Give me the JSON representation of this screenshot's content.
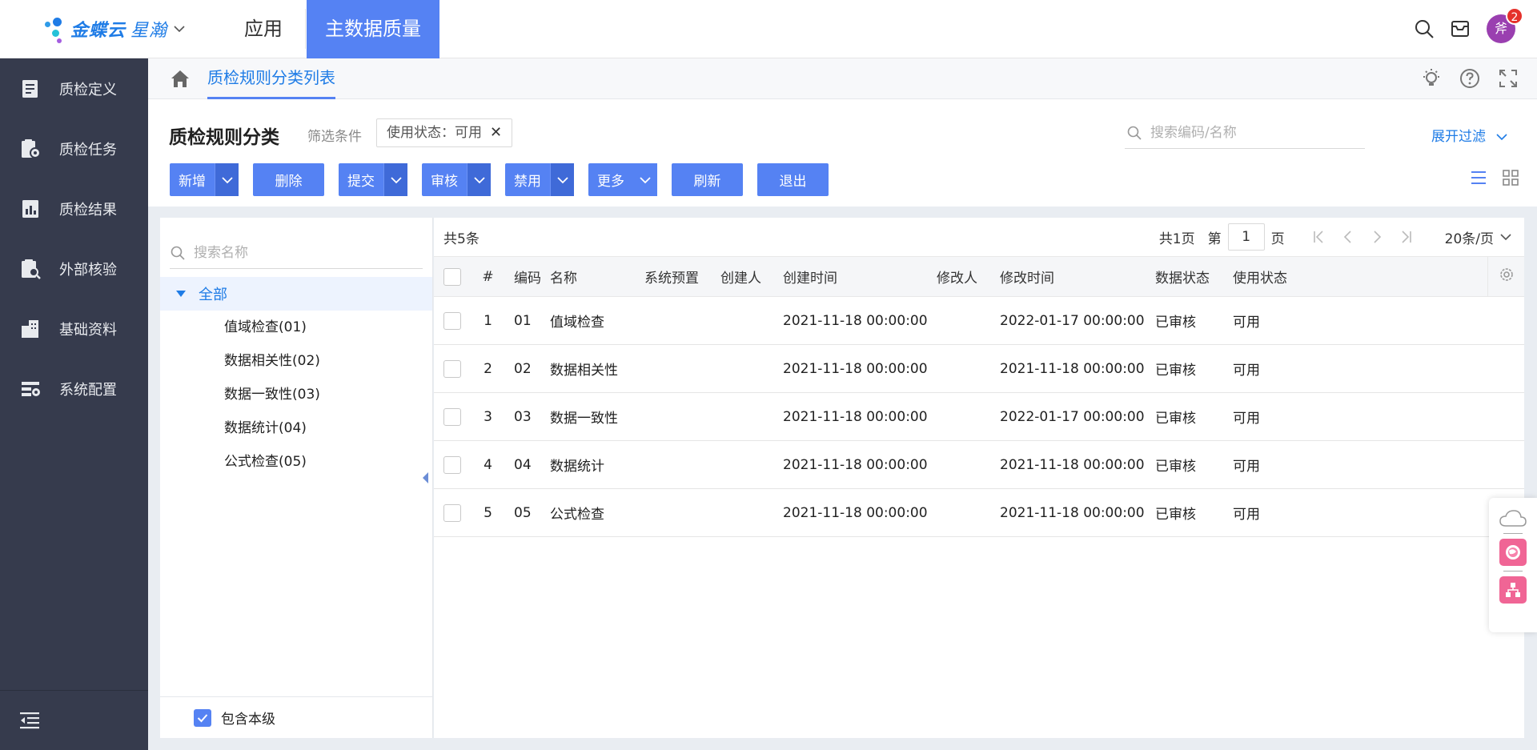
{
  "app": {
    "brand_main": "金蝶云",
    "brand_sub": "星瀚",
    "nav_apps": "应用",
    "nav_active": "主数据质量",
    "avatar_text": "斧",
    "notif_count": "2"
  },
  "sidebar": {
    "items": [
      {
        "label": "质检定义",
        "icon": "book-icon"
      },
      {
        "label": "质检任务",
        "icon": "task-gear-icon"
      },
      {
        "label": "质检结果",
        "icon": "report-icon"
      },
      {
        "label": "外部核验",
        "icon": "clipboard-search-icon"
      },
      {
        "label": "基础资料",
        "icon": "building-icon"
      },
      {
        "label": "系统配置",
        "icon": "config-icon"
      }
    ]
  },
  "breadcrumb": {
    "tab": "质检规则分类列表"
  },
  "header": {
    "title": "质检规则分类",
    "filter_label": "筛选条件",
    "filter_chip": "使用状态：可用",
    "search_placeholder": "搜索编码/名称",
    "expand_filter": "展开过滤"
  },
  "toolbar": {
    "new": "新增",
    "delete": "删除",
    "submit": "提交",
    "audit": "审核",
    "disable": "禁用",
    "more": "更多",
    "refresh": "刷新",
    "exit": "退出"
  },
  "tree": {
    "search_placeholder": "搜索名称",
    "root": "全部",
    "children": [
      "值域检查(01)",
      "数据相关性(02)",
      "数据一致性(03)",
      "数据统计(04)",
      "公式检查(05)"
    ],
    "include_self": "包含本级"
  },
  "grid": {
    "total": "共5条",
    "pages": "共1页",
    "page_prefix": "第",
    "page": "1",
    "page_suffix": "页",
    "page_size": "20条/页",
    "columns": [
      "#",
      "编码",
      "名称",
      "系统预置",
      "创建人",
      "创建时间",
      "修改人",
      "修改时间",
      "数据状态",
      "使用状态"
    ],
    "rows": [
      {
        "idx": "1",
        "code": "01",
        "name": "值域检查",
        "created": "2021-11-18 00:00:00",
        "modified": "2022-01-17 00:00:00",
        "data_status": "已审核",
        "use_status": "可用"
      },
      {
        "idx": "2",
        "code": "02",
        "name": "数据相关性",
        "created": "2021-11-18 00:00:00",
        "modified": "2021-11-18 00:00:00",
        "data_status": "已审核",
        "use_status": "可用"
      },
      {
        "idx": "3",
        "code": "03",
        "name": "数据一致性",
        "created": "2021-11-18 00:00:00",
        "modified": "2022-01-17 00:00:00",
        "data_status": "已审核",
        "use_status": "可用"
      },
      {
        "idx": "4",
        "code": "04",
        "name": "数据统计",
        "created": "2021-11-18 00:00:00",
        "modified": "2021-11-18 00:00:00",
        "data_status": "已审核",
        "use_status": "可用"
      },
      {
        "idx": "5",
        "code": "05",
        "name": "公式检查",
        "created": "2021-11-18 00:00:00",
        "modified": "2021-11-18 00:00:00",
        "data_status": "已审核",
        "use_status": "可用"
      }
    ]
  },
  "colors": {
    "primary": "#5582f3",
    "link": "#1f7ce6",
    "sidebar_bg": "#363b4d",
    "badge": "#e5312b"
  }
}
